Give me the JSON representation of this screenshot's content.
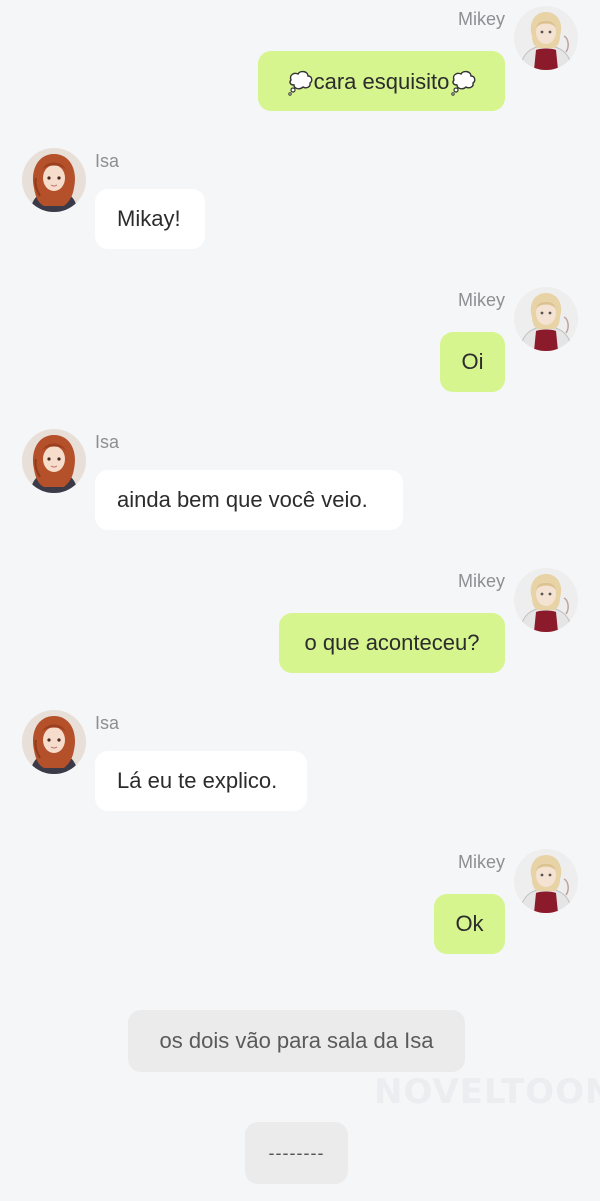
{
  "characters": {
    "mikey": {
      "name": "Mikey",
      "avatar_icon": "mikey-avatar-icon"
    },
    "isa": {
      "name": "Isa",
      "avatar_icon": "isa-avatar-icon"
    }
  },
  "messages": [
    {
      "speaker": "Mikey",
      "text": "cara esquisito",
      "style": "thought"
    },
    {
      "speaker": "Isa",
      "text": "Mikay!"
    },
    {
      "speaker": "Mikey",
      "text": "Oi"
    },
    {
      "speaker": "Isa",
      "text": "ainda bem que você veio."
    },
    {
      "speaker": "Mikey",
      "text": "o que aconteceu?"
    },
    {
      "speaker": "Isa",
      "text": "Lá eu te explico."
    },
    {
      "speaker": "Mikey",
      "text": "Ok"
    }
  ],
  "narration": {
    "text": "os dois vão para sala da Isa"
  },
  "separator": {
    "text": "--------"
  },
  "watermark": {
    "text": "NOVELTOON"
  },
  "colors": {
    "background": "#f5f6f8",
    "mikey_bubble": "#d6f58f",
    "isa_bubble": "#ffffff",
    "narration_bubble": "#ebebeb",
    "name_text": "#8e8e93"
  }
}
